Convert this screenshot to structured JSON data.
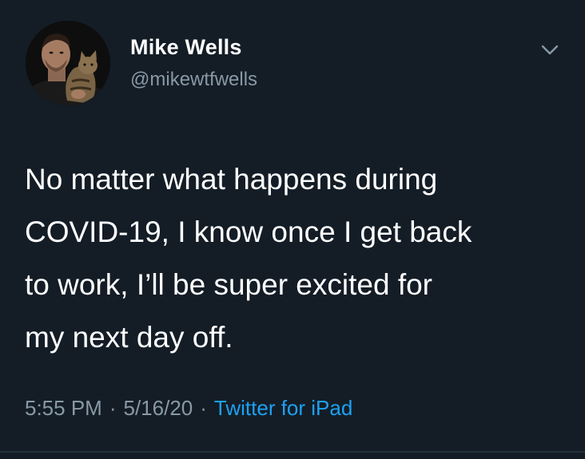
{
  "tweet": {
    "author_name": "Mike Wells",
    "author_handle": "@mikewtfwells",
    "text": "No matter what happens during\nCOVID-19, I know once I get back\nto work, I’ll be super excited for\nmy next day off.",
    "time": "5:55 PM",
    "separator": "·",
    "date": "5/16/20",
    "source": "Twitter for iPad"
  },
  "colors": {
    "background": "#141d26",
    "primary_text": "#ffffff",
    "secondary_text": "#8899a6",
    "link": "#1da1f2"
  },
  "icons": {
    "menu": "chevron-down-icon",
    "avatar": "profile-photo"
  }
}
